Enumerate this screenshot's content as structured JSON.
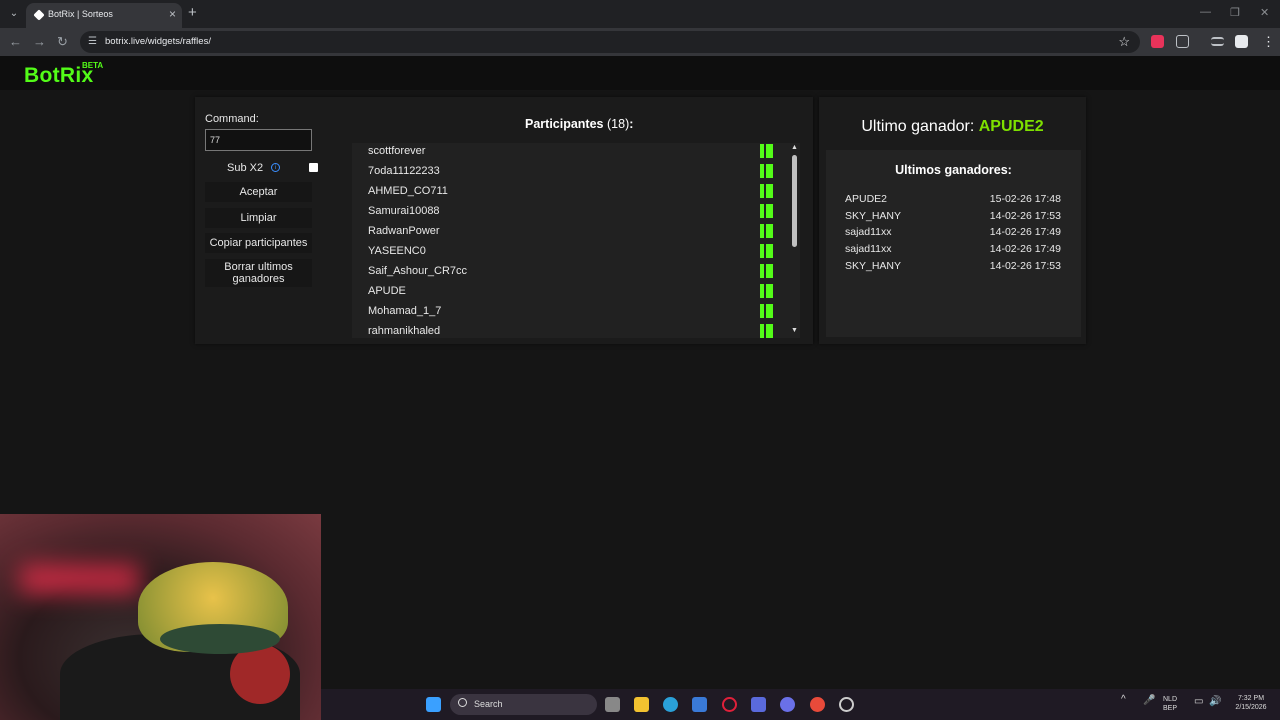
{
  "browser": {
    "tab_title": "BotRix | Sorteos",
    "url": "botrix.live/widgets/raffles/"
  },
  "site": {
    "logo": "BotRix",
    "beta": "BETA"
  },
  "controls": {
    "command_label": "Command:",
    "command_value": "77",
    "subx2_label": "Sub X2",
    "buttons": {
      "accept": "Aceptar",
      "clear": "Limpiar",
      "copy": "Copiar participantes",
      "delete_line1": "Borrar ultimos",
      "delete_line2": "ganadores"
    }
  },
  "participants": {
    "title": "Participantes",
    "count": "(18)",
    "colon": ":",
    "items": [
      "scottforever",
      "7oda11122233",
      "AHMED_CO711",
      "Samurai10088",
      "RadwanPower",
      "YASEENC0",
      "Saif_Ashour_CR7cc",
      "APUDE",
      "Mohamad_1_7",
      "rahmanikhaled"
    ]
  },
  "winner": {
    "label": "Ultimo ganador: ",
    "name": "APUDE2",
    "recent_title": "Ultimos ganadores:",
    "recent": [
      {
        "name": "APUDE2",
        "date": "15-02-26 17:48"
      },
      {
        "name": "SKY_HANY",
        "date": "14-02-26 17:53"
      },
      {
        "name": "sajad11xx",
        "date": "14-02-26 17:49"
      },
      {
        "name": "sajad11xx",
        "date": "14-02-26 17:49"
      },
      {
        "name": "SKY_HANY",
        "date": "14-02-26 17:53"
      }
    ]
  },
  "taskbar": {
    "search": "Search",
    "lang1": "NLD",
    "lang2": "BEP",
    "time": "7:32 PM",
    "date": "2/15/2026"
  },
  "colors": {
    "accent": "#53fc18",
    "winner": "#7ee000"
  }
}
